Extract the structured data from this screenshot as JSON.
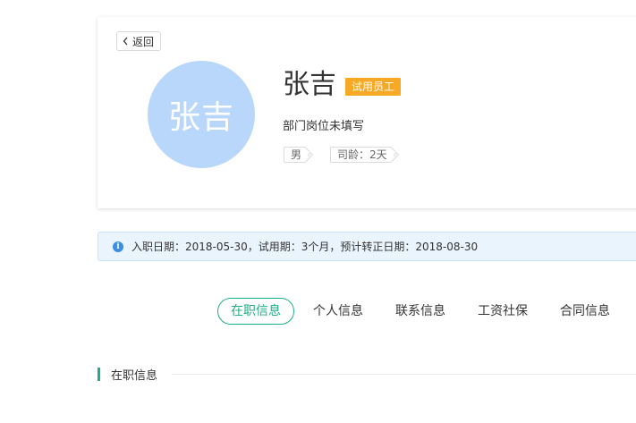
{
  "profile": {
    "back_label": "返回",
    "avatar_text": "张吉",
    "name": "张吉",
    "status_badge": "试用员工",
    "department": "部门岗位未填写",
    "gender": "男",
    "tenure": "司龄：2天"
  },
  "info_bar": {
    "text": "入职日期：2018-05-30，试用期：3个月，预计转正日期：2018-08-30"
  },
  "tabs": [
    {
      "label": "在职信息",
      "active": true
    },
    {
      "label": "个人信息",
      "active": false
    },
    {
      "label": "联系信息",
      "active": false
    },
    {
      "label": "工资社保",
      "active": false
    },
    {
      "label": "合同信息",
      "active": false
    }
  ],
  "section": {
    "title": "在职信息"
  },
  "colors": {
    "accent": "#1fae8a",
    "badge": "#f7a825",
    "avatar": "#b9d7fb",
    "info_icon": "#3a8ee6"
  },
  "icons": {
    "back": "chevron-left-icon",
    "info": "info-icon"
  }
}
